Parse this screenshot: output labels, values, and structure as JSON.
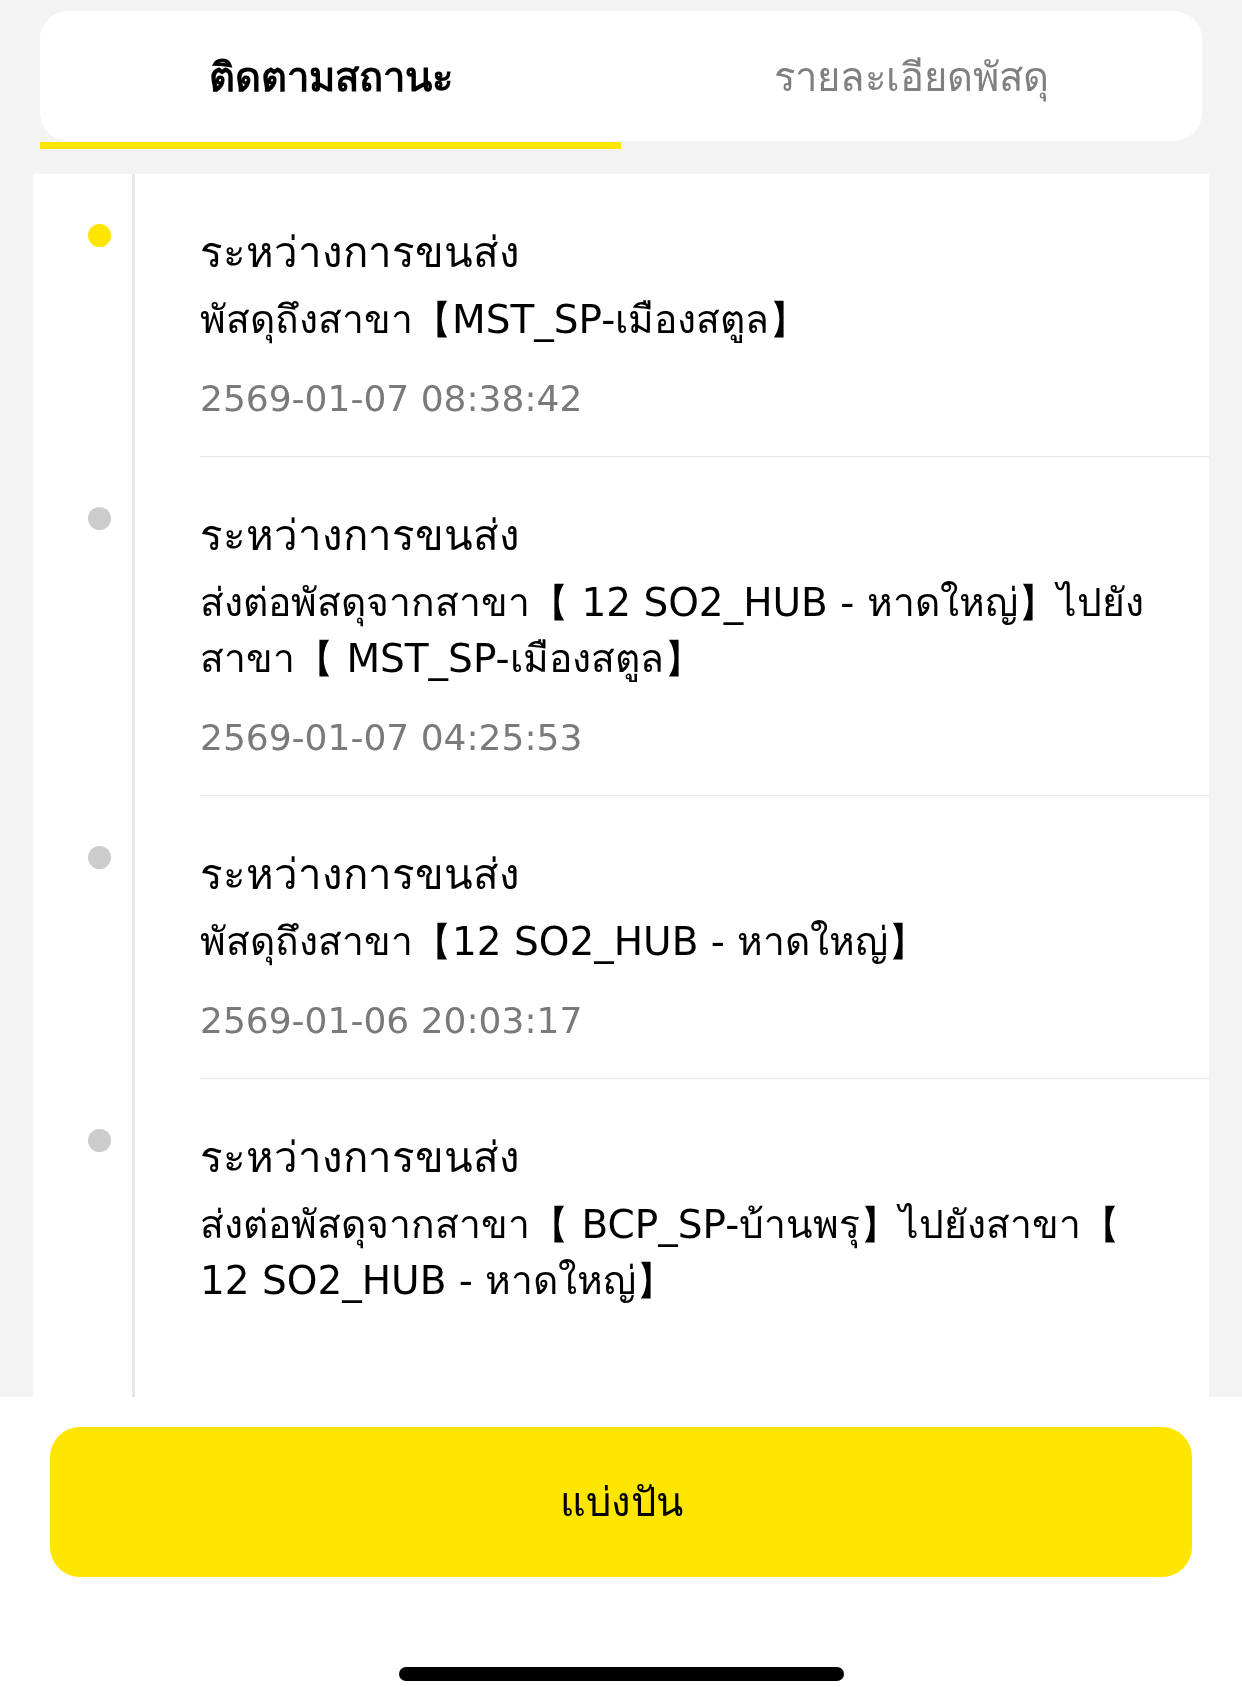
{
  "tabs": [
    {
      "label": "ติดตามสถานะ",
      "selected": true
    },
    {
      "label": "รายละเอียดพัสดุ",
      "selected": false
    }
  ],
  "timeline": [
    {
      "status": "ระหว่างการขนส่ง",
      "description": "พัสดุถึงสาขา【MST_SP-เมืองสตูล】",
      "time": "2569-01-07 08:38:42",
      "current": true
    },
    {
      "status": "ระหว่างการขนส่ง",
      "description": "ส่งต่อพัสดุจากสาขา【 12 SO2_HUB - หาดใหญ่】ไปยังสาขา【 MST_SP-เมืองสตูล】",
      "time": "2569-01-07 04:25:53",
      "current": false
    },
    {
      "status": "ระหว่างการขนส่ง",
      "description": "พัสดุถึงสาขา【12 SO2_HUB - หาดใหญ่】",
      "time": "2569-01-06 20:03:17",
      "current": false
    },
    {
      "status": "ระหว่างการขนส่ง",
      "description": "ส่งต่อพัสดุจากสาขา【 BCP_SP-บ้านพรุ】ไปยังสาขา【 12 SO2_HUB - หาดใหญ่】",
      "current": false
    }
  ],
  "share_button": {
    "label": "แบ่งปัน"
  }
}
